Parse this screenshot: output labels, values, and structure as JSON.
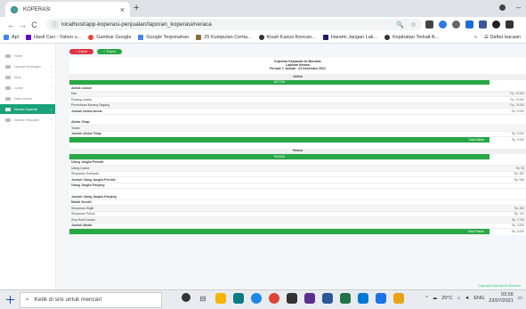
{
  "browser": {
    "tab_title": "KOPERASI",
    "url": "localhost/app-koperasi-penjualan/laporan_koperasi/neraca",
    "bookmarks": [
      "Apl",
      "Hasil Cari - Yahoo u...",
      "Gambar Google",
      "Google Terjemahan",
      "25 Kumpulan Cerita...",
      "Kisah Kasus Kencan...",
      "Harami Jangan Lak...",
      "Kejahatan Terkait A..."
    ],
    "bookmarks_right": "Daftar bacaan"
  },
  "sidebar": {
    "items": [
      {
        "label": "Home",
        "active": false
      },
      {
        "label": "Laporan Keuangan",
        "active": false
      },
      {
        "label": "Akun",
        "active": false
      },
      {
        "label": "Jurnal",
        "active": false
      },
      {
        "label": "Data Neraca",
        "active": false
      },
      {
        "label": "Neraca Koperasi",
        "active": true
      },
      {
        "label": "Neraca Penjualan",
        "active": false
      }
    ]
  },
  "actions": {
    "export_label": "Export",
    "print_label": "Export"
  },
  "report": {
    "org": "Koperasi Karyawan Ar-Barokah",
    "title": "Laporan Neraca",
    "period": "Periode 1 Januari - 31 Desember 2021",
    "section1_head": "Aktiva",
    "section1_bar": "AKTIVA",
    "aktiva_lancar": "Aktiva Lancar",
    "rows1": [
      {
        "label": "Kas",
        "value": "Rp. 10.000"
      },
      {
        "label": "Piutang Usaha",
        "value": "Rp. 10.000"
      },
      {
        "label": "Persediaan Barang Dagang",
        "value": "Rp. 70.000"
      }
    ],
    "total_lancar": {
      "label": "Jumlah Aktiva lancar",
      "value": "Rp. 5.000"
    },
    "aktiva_tetap": "Aktiva Tetap",
    "rows_tetap": [
      {
        "label": "Tanah",
        "value": ""
      }
    ],
    "total_tetap": {
      "label": "Jumlah Aktiva Tetap",
      "value": "Rp. 5.000"
    },
    "total_aktiva": {
      "label": "Total Aktiva",
      "value": "Rp. 5.000"
    },
    "section2_head": "Pasiva",
    "section2_bar": "PASIVA",
    "utang_pendek": "Utang Jangka Pendek",
    "rows2": [
      {
        "label": "Utang Usaha",
        "value": "Rp. 35"
      },
      {
        "label": "Simpanan Sukarela",
        "value": "Rp. 800"
      }
    ],
    "total_pendek": {
      "label": "Jumlah Utang Jangka Pendek",
      "value": "Rp. 835"
    },
    "utang_panjang": "Utang Jangka Panjang",
    "total_panjang": {
      "label": "Jumlah Utang Jangka Panjang",
      "value": ""
    },
    "modal_head": "Modal Sendiri",
    "rows3": [
      {
        "label": "Simpanan Wajib",
        "value": "Rp. 800"
      },
      {
        "label": "Simpanan Pokok",
        "value": "Rp. 100"
      },
      {
        "label": "Sisa Hasil Usaha",
        "value": "Rp. 2.700"
      }
    ],
    "total_modal": {
      "label": "Jumlah Modal",
      "value": "Rp. 3.600"
    },
    "total_pasiva": {
      "label": "Total Pasiva",
      "value": "Rp. 5.000"
    }
  },
  "footer_link": "Copyright Koperasi Ar-Barokah",
  "taskbar": {
    "search_placeholder": "Ketik di sini untuk mencari",
    "weather": "20°C",
    "time": "03.56",
    "date": "22/07/2021"
  }
}
